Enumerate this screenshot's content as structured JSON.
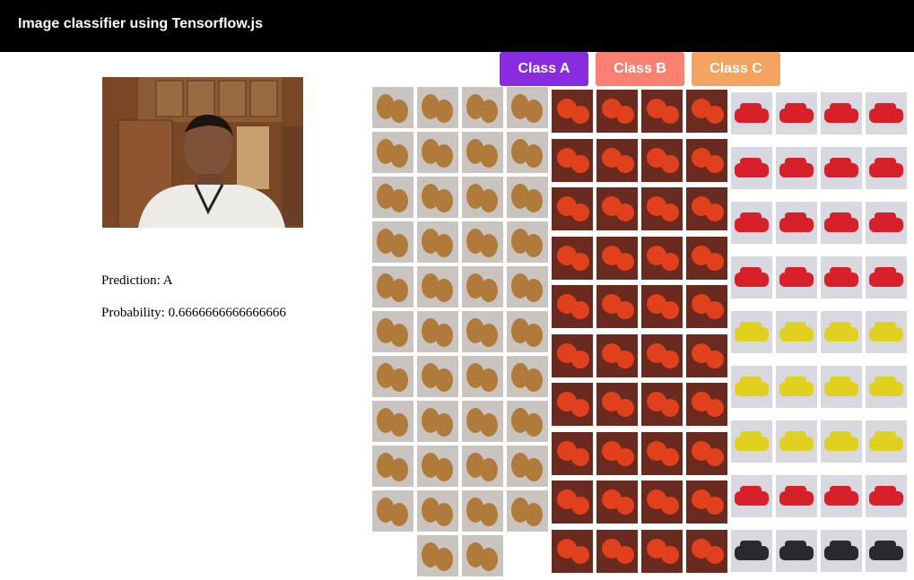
{
  "header": {
    "title": "Image classifier using Tensorflow.js"
  },
  "webcam": {
    "label": "webcam-feed"
  },
  "result": {
    "prediction_text": "Prediction: A",
    "probability_text": "Probability: 0.6666666666666666"
  },
  "classes": [
    {
      "label": "Class A",
      "color": "#8a2be2"
    },
    {
      "label": "Class B",
      "color": "#fa8072"
    },
    {
      "label": "Class C",
      "color": "#f4a460"
    }
  ],
  "sample_groups": [
    {
      "class": "A",
      "subject": "potatoes",
      "count": 42,
      "tone": "#b07a3a",
      "bg": "#c9c4c0"
    },
    {
      "class": "B",
      "subject": "tomatoes",
      "count": 40,
      "tone": "#e0401c",
      "bg": "#6a2a20"
    },
    {
      "class": "C",
      "subject": "cars",
      "count": 40,
      "tone": "#d8202a",
      "bg": "#d8d8e0"
    }
  ]
}
